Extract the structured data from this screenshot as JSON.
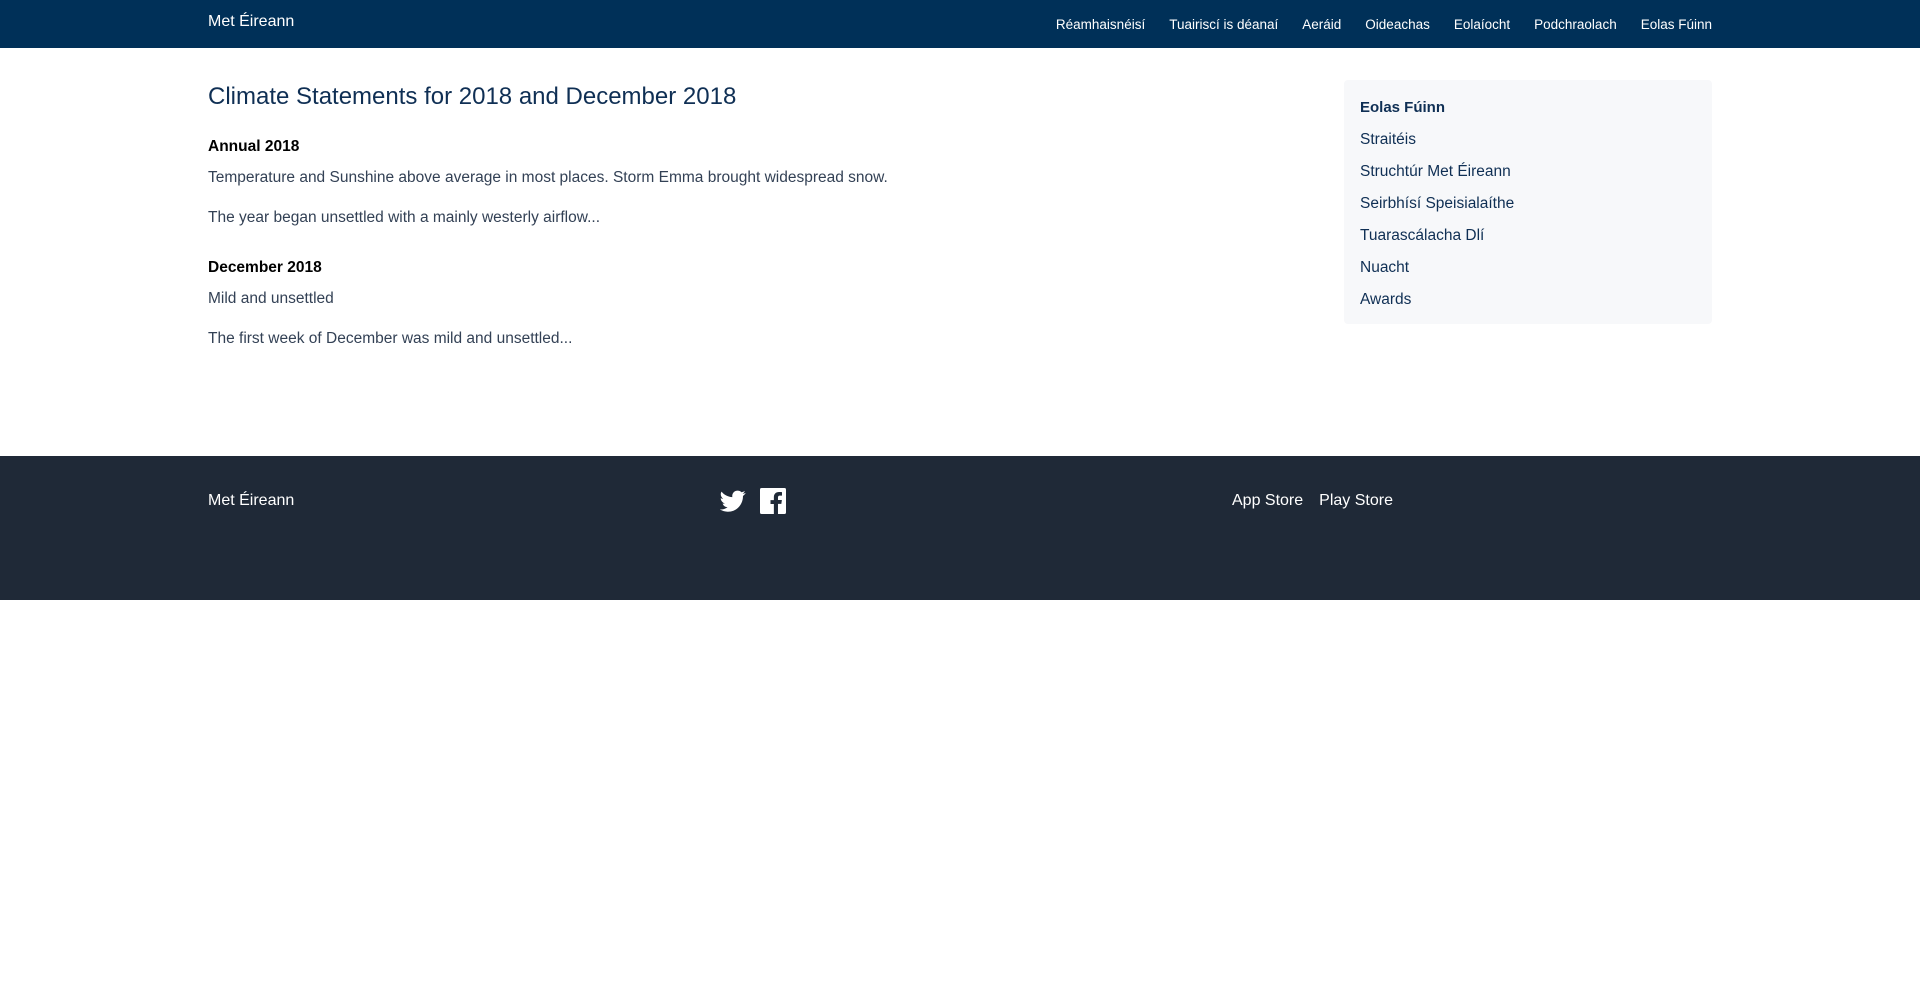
{
  "header": {
    "brand": "Met Éireann",
    "nav": [
      {
        "label": "Réamhaisnéisí"
      },
      {
        "label": "Tuairiscí is déanaí"
      },
      {
        "label": "Aeráid"
      },
      {
        "label": "Oideachas"
      },
      {
        "label": "Eolaíocht"
      },
      {
        "label": "Podchraolach"
      },
      {
        "label": "Eolas Fúinn"
      }
    ]
  },
  "main": {
    "title": "Climate Statements for 2018 and December 2018",
    "sections": [
      {
        "heading": "Annual 2018",
        "summary": "Temperature and Sunshine above average in most places. Storm Emma brought widespread snow.",
        "excerpt": "The year began unsettled with a mainly westerly airflow..."
      },
      {
        "heading": "December 2018",
        "summary": "Mild and unsettled",
        "excerpt": "The first week of December was mild and unsettled..."
      }
    ]
  },
  "sidebar": {
    "title": "Eolas Fúinn",
    "items": [
      {
        "label": "Straitéis"
      },
      {
        "label": "Struchtúr Met Éireann"
      },
      {
        "label": "Seirbhísí Speisialaíthe"
      },
      {
        "label": "Tuarascálacha Dlí"
      },
      {
        "label": "Nuacht"
      },
      {
        "label": "Awards"
      }
    ]
  },
  "footer": {
    "brand": "Met Éireann",
    "social": [
      {
        "icon": "twitter-icon"
      },
      {
        "icon": "facebook-icon"
      }
    ],
    "stores": [
      {
        "label": "App Store"
      },
      {
        "label": "Play Store"
      }
    ]
  },
  "colors": {
    "header_bg": "#003058",
    "footer_bg": "#1f2937",
    "heading": "#0f2f54",
    "sidebar_bg": "#f7f8fa"
  }
}
